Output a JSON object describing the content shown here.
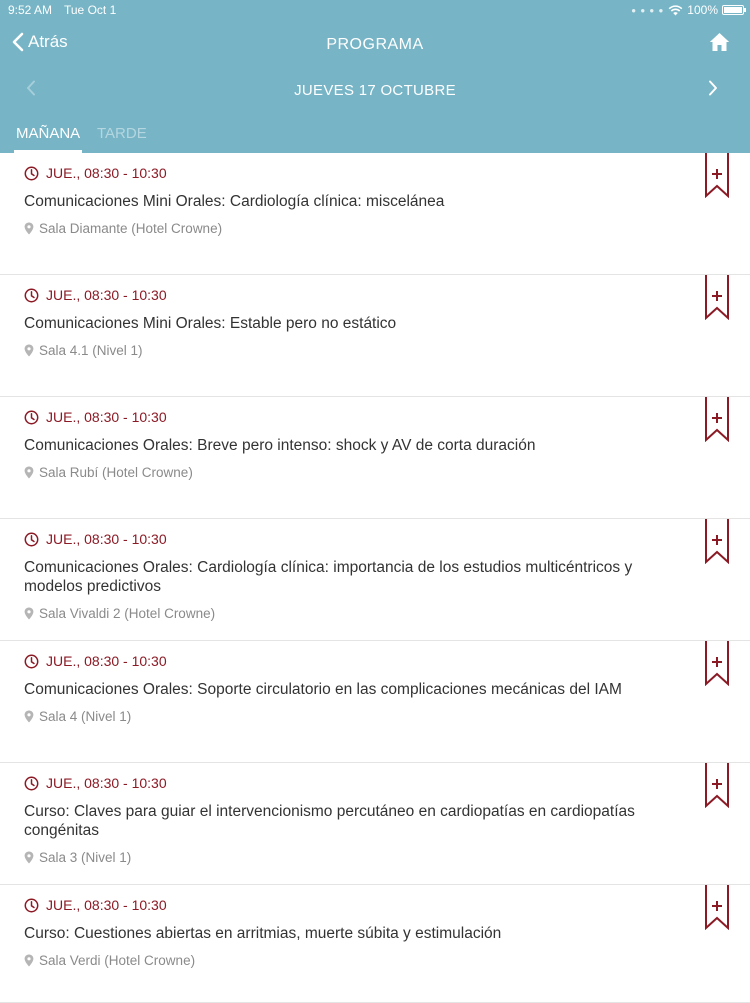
{
  "status": {
    "time": "9:52 AM",
    "date": "Tue Oct 1",
    "battery": "100%",
    "wifi_icon": "wifi-icon"
  },
  "nav": {
    "back_label": "Atrás",
    "title": "PROGRAMA",
    "home_icon": "home-icon"
  },
  "day": {
    "label": "JUEVES 17 OCTUBRE"
  },
  "tabs": [
    {
      "label": "MAÑANA",
      "active": true
    },
    {
      "label": "TARDE",
      "active": false
    }
  ],
  "colors": {
    "header": "#76b4c6",
    "accent": "#8b1a25",
    "muted": "#8a8a8a"
  },
  "sessions": [
    {
      "time": "JUE., 08:30 - 10:30",
      "title": "Comunicaciones Mini Orales: Cardiología clínica: miscelánea",
      "location": "Sala Diamante (Hotel Crowne)"
    },
    {
      "time": "JUE., 08:30 - 10:30",
      "title": "Comunicaciones Mini Orales: Estable pero no estático",
      "location": "Sala 4.1 (Nivel 1)"
    },
    {
      "time": "JUE., 08:30 - 10:30",
      "title": "Comunicaciones Orales: Breve pero intenso: shock y AV de corta duración",
      "location": "Sala Rubí (Hotel Crowne)"
    },
    {
      "time": "JUE., 08:30 - 10:30",
      "title": "Comunicaciones Orales: Cardiología clínica: importancia de los estudios multicéntricos y modelos predictivos",
      "location": "Sala Vivaldi 2 (Hotel Crowne)"
    },
    {
      "time": "JUE., 08:30 - 10:30",
      "title": "Comunicaciones Orales: Soporte circulatorio en las complicaciones mecánicas del IAM",
      "location": "Sala 4 (Nivel 1)"
    },
    {
      "time": "JUE., 08:30 - 10:30",
      "title": "Curso: Claves para guiar el intervencionismo percutáneo en cardiopatías en cardiopatías congénitas",
      "location": "Sala 3 (Nivel 1)"
    },
    {
      "time": "JUE., 08:30 - 10:30",
      "title": "Curso: Cuestiones abiertas en arritmias, muerte súbita  y estimulación",
      "location": "Sala Verdi (Hotel Crowne)"
    }
  ]
}
